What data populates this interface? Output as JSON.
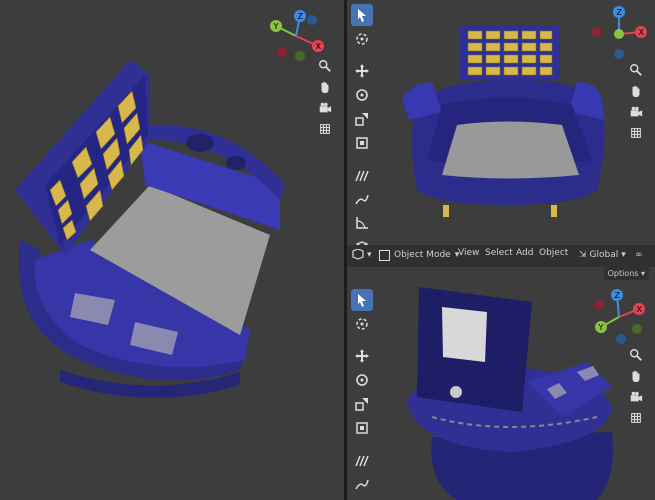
{
  "header": {
    "mode_label": "Object Mode",
    "menu": [
      "View",
      "Select",
      "Add",
      "Object"
    ],
    "orientation_label": "Global",
    "options_label": "Options"
  },
  "gizmo_axes": {
    "x": "X",
    "y": "Y",
    "z": "Z"
  },
  "colors": {
    "viewport_bg": "#3d3d3d",
    "panel_bg": "#303030",
    "active_tool": "#4772b3",
    "model_blue": "#2f2f9a",
    "model_light_blue": "#3b3bb8",
    "seat_grey": "#9a9a9a",
    "gold": "#d8b84a",
    "axis_x": "#e54252",
    "axis_y": "#8bc53f",
    "axis_z": "#3b8ee6"
  },
  "tools": [
    "select-box-icon",
    "cursor-icon",
    "move-icon",
    "rotate-icon",
    "scale-icon",
    "transform-icon",
    "annotate-icon",
    "draw-icon",
    "measure-icon",
    "add-cube-icon"
  ],
  "nav_icons": [
    "zoom-icon",
    "pan-hand-icon",
    "camera-icon",
    "grid-icon"
  ]
}
